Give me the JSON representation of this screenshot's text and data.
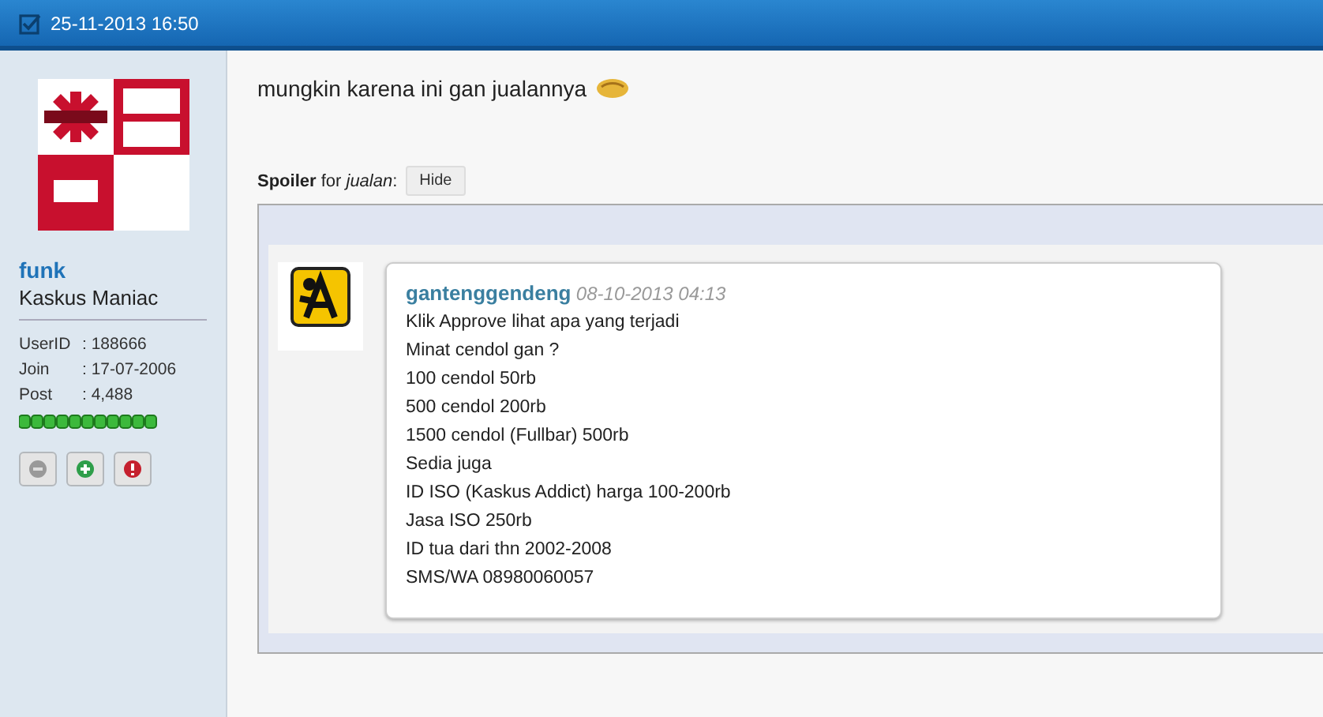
{
  "header": {
    "datetime": "25-11-2013 16:50"
  },
  "user": {
    "name": "funk",
    "rank": "Kaskus Maniac",
    "stats": [
      {
        "label": "UserID",
        "value": ": 188666"
      },
      {
        "label": "Join",
        "value": ": 17-07-2006"
      },
      {
        "label": "Post",
        "value": ": 4,488"
      }
    ]
  },
  "post": {
    "text": "mungkin karena ini gan jualannya",
    "spoiler": {
      "label": "**Spoiler** for *jualan*:",
      "button": "Hide"
    }
  },
  "quote": {
    "author": "gantenggendeng",
    "date": "08-10-2013 04:13",
    "lines": [
      "Klik Approve lihat apa yang terjadi",
      "Minat cendol gan ?",
      "100 cendol 50rb",
      "500 cendol 200rb",
      "1500 cendol (Fullbar) 500rb",
      "Sedia juga",
      "ID ISO (Kaskus Addict) harga 100-200rb",
      "Jasa ISO 250rb",
      "ID tua dari thn 2002-2008",
      "SMS/WA 08980060057"
    ]
  }
}
